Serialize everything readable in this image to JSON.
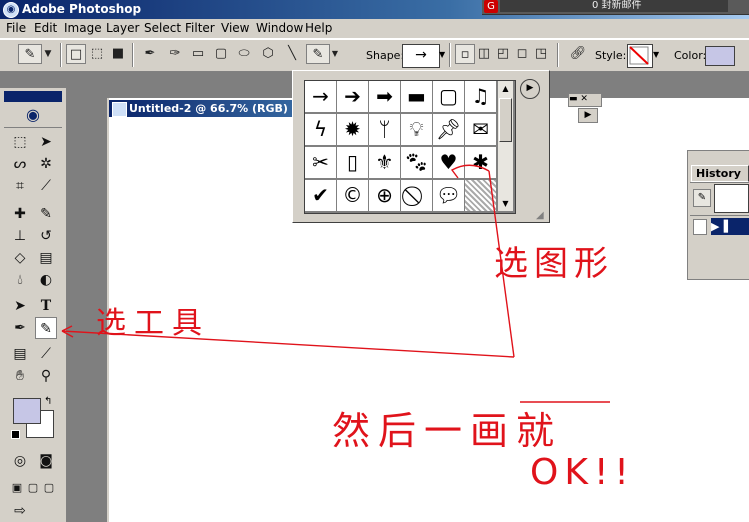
{
  "window": {
    "title": "Adobe Photoshop",
    "app_icon": "photoshop-eye-icon"
  },
  "notification": {
    "text": "0 封新邮件"
  },
  "menu": [
    {
      "label": "File",
      "key": "F"
    },
    {
      "label": "Edit",
      "key": "E"
    },
    {
      "label": "Image",
      "key": "I"
    },
    {
      "label": "Layer",
      "key": "L"
    },
    {
      "label": "Select",
      "key": "S"
    },
    {
      "label": "Filter",
      "key": "T"
    },
    {
      "label": "View",
      "key": "V"
    },
    {
      "label": "Window",
      "key": "W"
    },
    {
      "label": "Help",
      "key": "H"
    }
  ],
  "options": {
    "shape_label": "Shape:",
    "style_label": "Style:",
    "color_label": "Color:",
    "shape_value": "→"
  },
  "document": {
    "title": "Untitled-2 @ 66.7% (RGB)"
  },
  "history": {
    "title": "History"
  },
  "shapes": [
    "arrow-thin",
    "arrow-medium",
    "arrow-bold",
    "banner",
    "frame",
    "music-note",
    "lightning",
    "starburst",
    "grass",
    "lightbulb",
    "thumbtack",
    "envelope",
    "scissors",
    "blank-frame",
    "fleur-de-lis",
    "cat-paw",
    "heart",
    "ink-blot",
    "checkmark",
    "copyright",
    "target",
    "no-sign",
    "speech-bubble",
    "hatch-pattern"
  ],
  "colors": {
    "accent": "#0a246a",
    "annotation": "#e0131b",
    "fill_swatch": "#c6c6e6"
  },
  "annotations": {
    "note_tool": "选工具",
    "note_shape": "选图形",
    "note_then": "然后一画就",
    "note_ok": "OK!!"
  }
}
